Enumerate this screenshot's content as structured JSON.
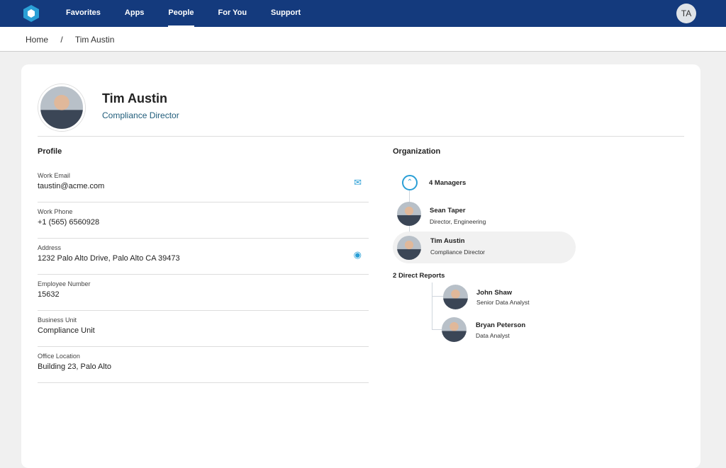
{
  "nav": {
    "items": [
      "Favorites",
      "Apps",
      "People",
      "For You",
      "Support"
    ],
    "active": "People",
    "user_initials": "TA"
  },
  "breadcrumb": {
    "home": "Home",
    "sep": "/",
    "current": "Tim Austin"
  },
  "profile": {
    "name": "Tim Austin",
    "title": "Compliance Director",
    "section": "Profile",
    "fields": [
      {
        "label": "Work Email",
        "value": "taustin@acme.com",
        "icon": "mail-icon"
      },
      {
        "label": "Work Phone",
        "value": "+1 (565) 6560928"
      },
      {
        "label": "Address",
        "value": "1232 Palo Alto Drive, Palo Alto CA 39473",
        "icon": "location-pin-icon"
      },
      {
        "label": "Employee Number",
        "value": "15632"
      },
      {
        "label": "Business Unit",
        "value": "Compliance Unit"
      },
      {
        "label": "Office Location",
        "value": "Building 23, Palo Alto"
      }
    ]
  },
  "org": {
    "section": "Organization",
    "managers_label": "4 Managers",
    "manager": {
      "name": "Sean Taper",
      "title": "Director, Engineering"
    },
    "self": {
      "name": "Tim Austin",
      "title": "Compliance Director"
    },
    "reports_count": "2",
    "reports_label": "Direct Reports",
    "reports": [
      {
        "name": "John Shaw",
        "title": "Senior Data Analyst"
      },
      {
        "name": "Bryan Peterson",
        "title": "Data Analyst"
      }
    ]
  }
}
